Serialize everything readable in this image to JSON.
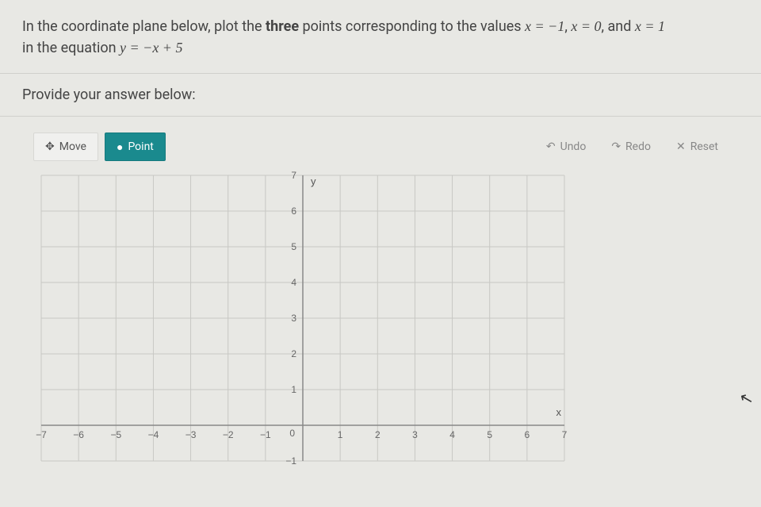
{
  "question": {
    "line1_pre": "In the coordinate plane below, plot the ",
    "line1_bold": "three",
    "line1_post": " points corresponding to the values ",
    "eq1": "x = −1",
    "sep1": ", ",
    "eq2": "x = 0",
    "sep2": ", and ",
    "eq3": "x = 1",
    "line2_pre": "in the equation ",
    "eq4": "y = −x + 5"
  },
  "answer_prompt": "Provide your answer below:",
  "toolbar": {
    "move": "Move",
    "point": "Point",
    "undo": "Undo",
    "redo": "Redo",
    "reset": "Reset"
  },
  "chart_data": {
    "type": "scatter",
    "title": "",
    "xlabel": "x",
    "ylabel": "y",
    "xlim": [
      -7,
      7
    ],
    "ylim": [
      -1,
      7
    ],
    "xticks": [
      -7,
      -6,
      -5,
      -4,
      -3,
      -2,
      -1,
      0,
      1,
      2,
      3,
      4,
      5,
      6,
      7
    ],
    "yticks": [
      -1,
      0,
      1,
      2,
      3,
      4,
      5,
      6,
      7
    ],
    "series": []
  }
}
